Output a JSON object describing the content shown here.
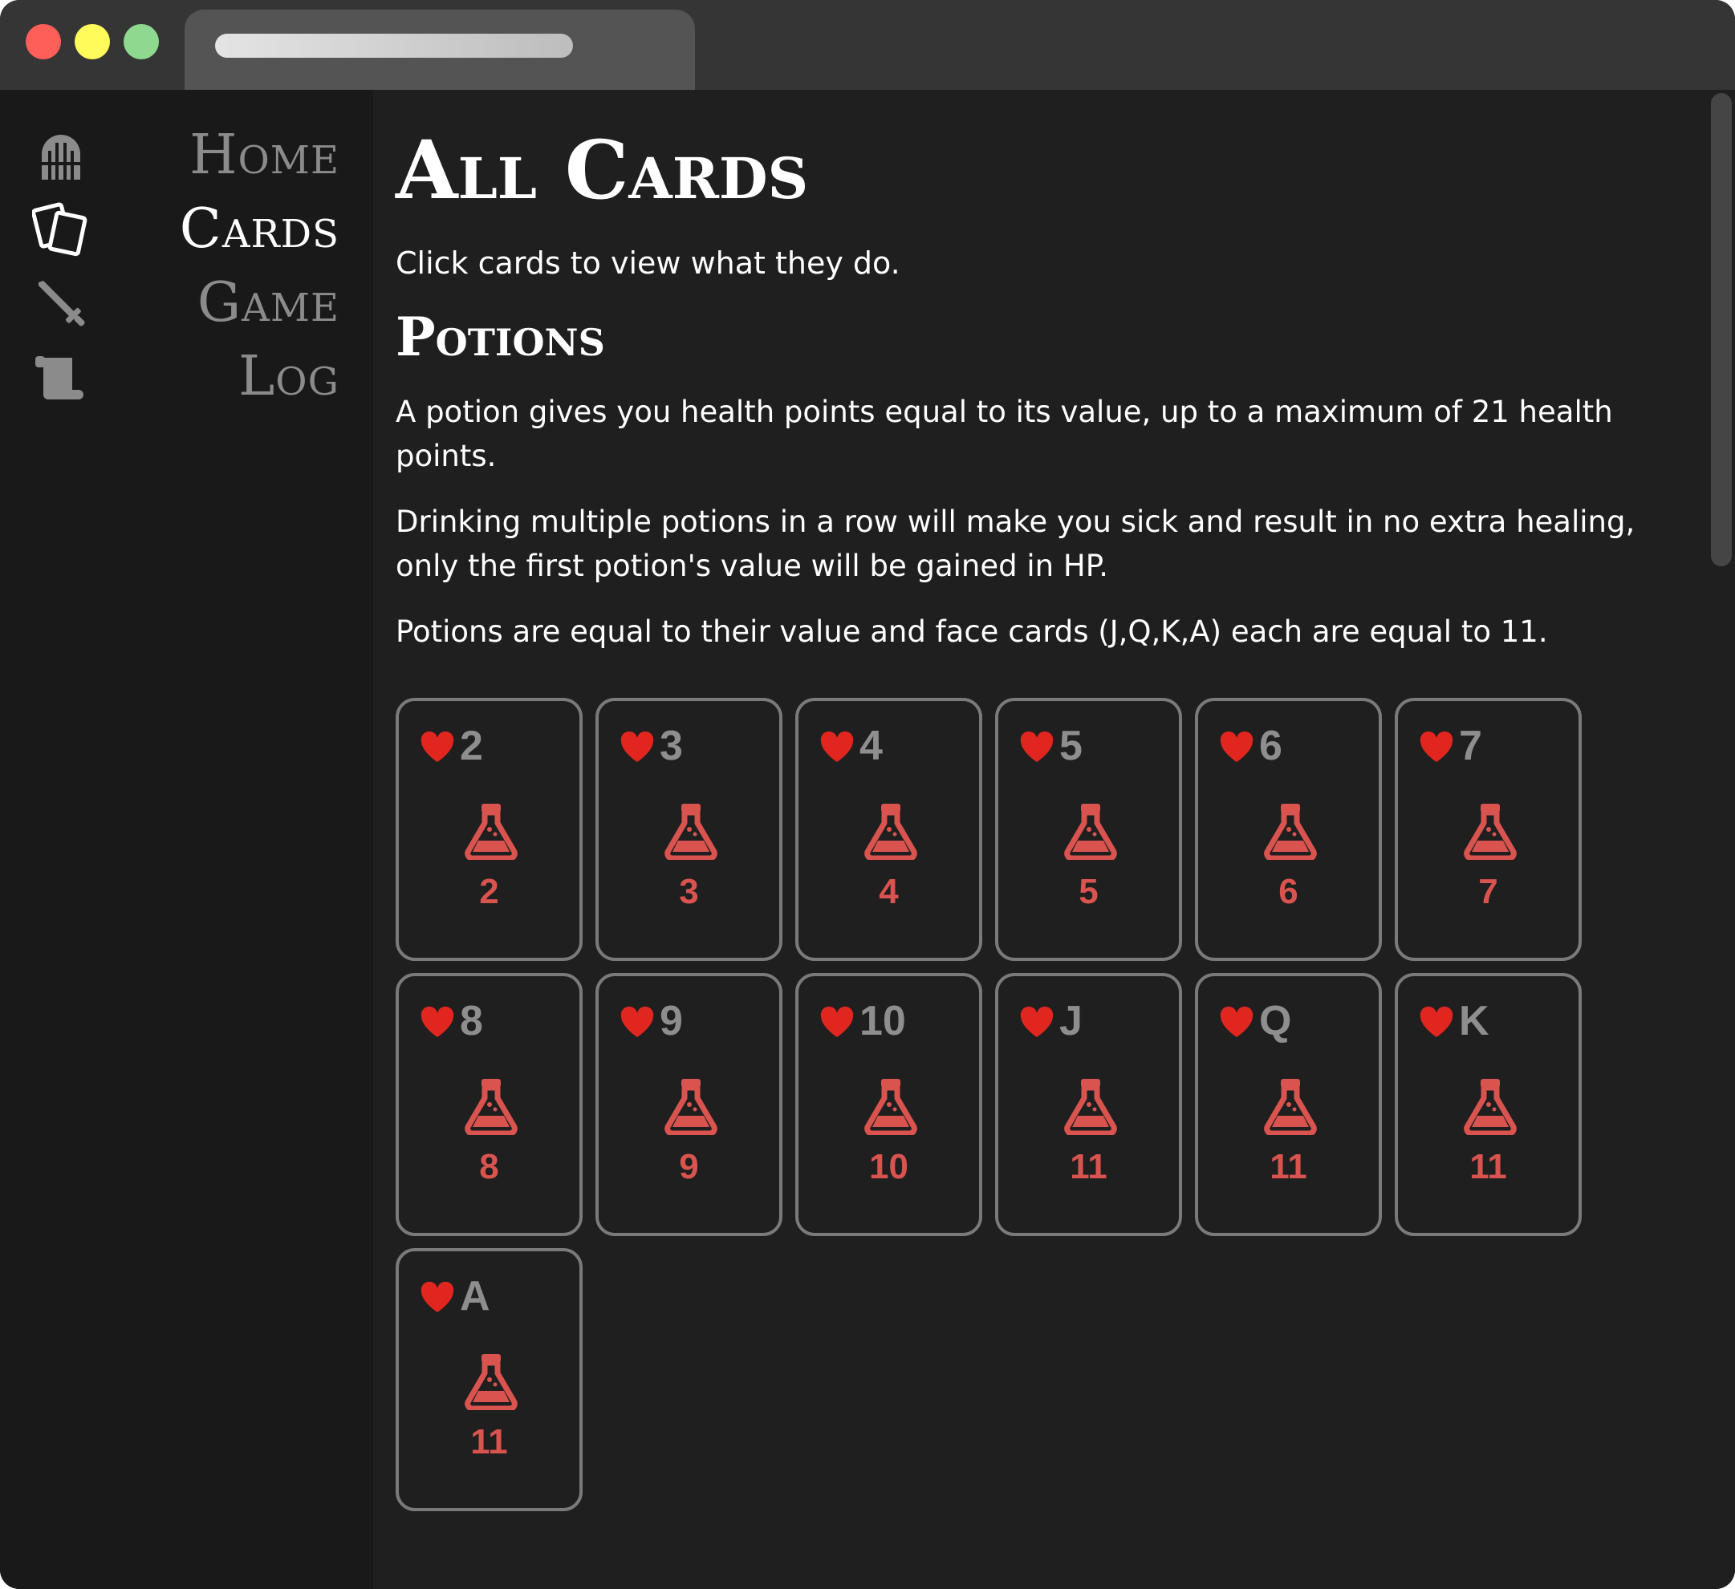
{
  "colors": {
    "accent_red": "#d9534f",
    "heart_red": "#e0261f",
    "nav_inactive": "#8b8b8b",
    "nav_active": "#ffffff"
  },
  "browser": {
    "tab_title": ""
  },
  "sidebar": {
    "items": [
      {
        "label": "Home",
        "icon": "dungeon-gate-icon",
        "active": false
      },
      {
        "label": "Cards",
        "icon": "cards-icon",
        "active": true
      },
      {
        "label": "Game",
        "icon": "sword-icon",
        "active": false
      },
      {
        "label": "Log",
        "icon": "scroll-icon",
        "active": false
      }
    ]
  },
  "main": {
    "title": "All Cards",
    "subtitle": "Click cards to view what they do.",
    "section_title": "Potions",
    "paragraphs": [
      "A potion gives you health points equal to its value, up to a maximum of 21 health points.",
      "Drinking multiple potions in a row will make you sick and result in no extra healing, only the first potion's value will be gained in HP.",
      "Potions are equal to their value and face cards (J,Q,K,A) each are equal to 11."
    ]
  },
  "cards": [
    {
      "suit": "heart-icon",
      "rank": "2",
      "icon": "potion-flask-icon",
      "value": "2"
    },
    {
      "suit": "heart-icon",
      "rank": "3",
      "icon": "potion-flask-icon",
      "value": "3"
    },
    {
      "suit": "heart-icon",
      "rank": "4",
      "icon": "potion-flask-icon",
      "value": "4"
    },
    {
      "suit": "heart-icon",
      "rank": "5",
      "icon": "potion-flask-icon",
      "value": "5"
    },
    {
      "suit": "heart-icon",
      "rank": "6",
      "icon": "potion-flask-icon",
      "value": "6"
    },
    {
      "suit": "heart-icon",
      "rank": "7",
      "icon": "potion-flask-icon",
      "value": "7"
    },
    {
      "suit": "heart-icon",
      "rank": "8",
      "icon": "potion-flask-icon",
      "value": "8"
    },
    {
      "suit": "heart-icon",
      "rank": "9",
      "icon": "potion-flask-icon",
      "value": "9"
    },
    {
      "suit": "heart-icon",
      "rank": "10",
      "icon": "potion-flask-icon",
      "value": "10"
    },
    {
      "suit": "heart-icon",
      "rank": "J",
      "icon": "potion-flask-icon",
      "value": "11"
    },
    {
      "suit": "heart-icon",
      "rank": "Q",
      "icon": "potion-flask-icon",
      "value": "11"
    },
    {
      "suit": "heart-icon",
      "rank": "K",
      "icon": "potion-flask-icon",
      "value": "11"
    },
    {
      "suit": "heart-icon",
      "rank": "A",
      "icon": "potion-flask-icon",
      "value": "11"
    }
  ]
}
